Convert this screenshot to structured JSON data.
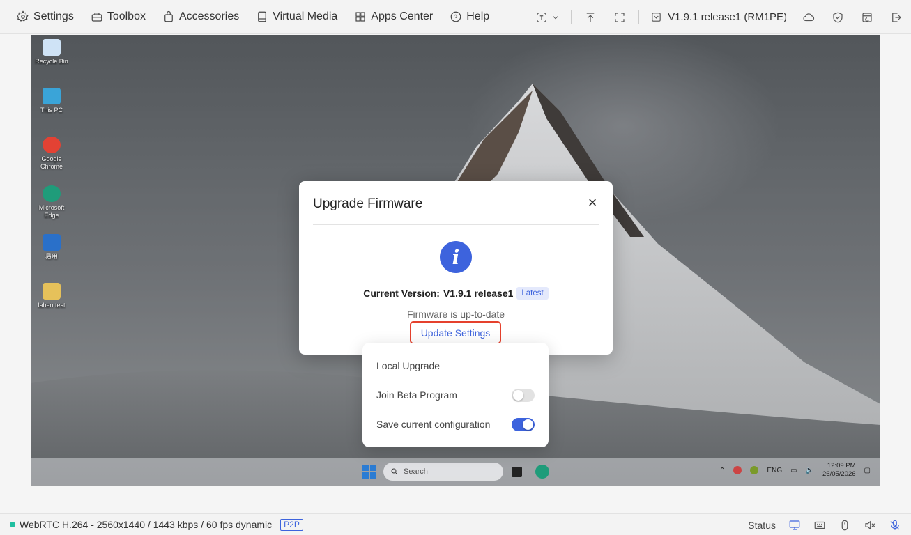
{
  "topbar": {
    "menu": [
      {
        "label": "Settings",
        "icon": "gear-icon"
      },
      {
        "label": "Toolbox",
        "icon": "toolbox-icon"
      },
      {
        "label": "Accessories",
        "icon": "bag-icon"
      },
      {
        "label": "Virtual Media",
        "icon": "drive-icon"
      },
      {
        "label": "Apps Center",
        "icon": "apps-grid-icon"
      },
      {
        "label": "Help",
        "icon": "help-circle-icon"
      }
    ],
    "version_label": "V1.9.1 release1 (RM1PE)"
  },
  "desktop": {
    "icons": [
      {
        "label": "Recycle Bin",
        "color": "#cfe3f6"
      },
      {
        "label": "This PC",
        "color": "#3aa4d8"
      },
      {
        "label": "Google Chrome",
        "color": "#e34234"
      },
      {
        "label": "Microsoft Edge",
        "color": "#1f9c7a"
      },
      {
        "label": "易用",
        "color": "#2a70c9"
      },
      {
        "label": "lahen test",
        "color": "#e6c15a"
      }
    ],
    "taskbar": {
      "search_placeholder": "Search",
      "tray_lang": "ENG",
      "time": "12:09 PM",
      "date": "26/05/2026"
    }
  },
  "modal": {
    "title": "Upgrade Firmware",
    "close_glyph": "×",
    "icon_glyph": "i",
    "current_version_prefix": "Current Version:",
    "current_version": "V1.9.1 release1",
    "badge": "Latest",
    "status_text": "Firmware is up-to-date",
    "update_settings_link": "Update Settings"
  },
  "popover": {
    "local_upgrade": "Local Upgrade",
    "beta_label": "Join Beta Program",
    "beta_enabled": false,
    "save_config_label": "Save current configuration",
    "save_config_enabled": true
  },
  "statusbar": {
    "stream_info": "WebRTC H.264 - 2560x1440 / 1443 kbps / 60 fps dynamic",
    "connection_badge": "P2P",
    "status_label": "Status"
  },
  "colors": {
    "accent": "#3d63dd",
    "highlight": "#e5412d",
    "online": "#1fbfa0"
  }
}
